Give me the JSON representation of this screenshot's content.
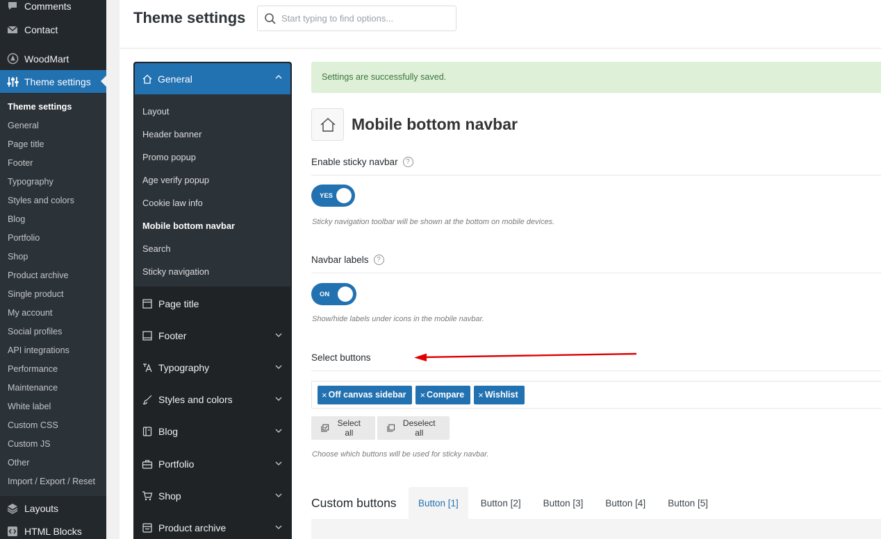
{
  "wp_menu": {
    "top_items": [
      {
        "label": "Comments",
        "icon": "comments-icon"
      },
      {
        "label": "Contact",
        "icon": "mail-icon"
      },
      {
        "label": "WoodMart",
        "icon": "woodmart-icon"
      },
      {
        "label": "Theme settings",
        "icon": "sliders-icon"
      }
    ],
    "submenu": [
      "Theme settings",
      "General",
      "Page title",
      "Footer",
      "Typography",
      "Styles and colors",
      "Blog",
      "Portfolio",
      "Shop",
      "Product archive",
      "Single product",
      "My account",
      "Social profiles",
      "API integrations",
      "Performance",
      "Maintenance",
      "White label",
      "Custom CSS",
      "Custom JS",
      "Other",
      "Import / Export / Reset"
    ],
    "bottom_items": [
      {
        "label": "Layouts",
        "icon": "layers-icon"
      },
      {
        "label": "HTML Blocks",
        "icon": "code-icon"
      }
    ]
  },
  "header": {
    "title": "Theme settings",
    "search_placeholder": "Start typing to find options..."
  },
  "settings_nav": {
    "active_group": "General",
    "active_subitems": [
      "Layout",
      "Header banner",
      "Promo popup",
      "Age verify popup",
      "Cookie law info",
      "Mobile bottom navbar",
      "Search",
      "Sticky navigation"
    ],
    "groups": [
      "Page title",
      "Footer",
      "Typography",
      "Styles and colors",
      "Blog",
      "Portfolio",
      "Shop",
      "Product archive"
    ]
  },
  "notice": "Settings are successfully saved.",
  "section": {
    "title": "Mobile bottom navbar",
    "help_glyph": "?",
    "sticky": {
      "label": "Enable sticky navbar",
      "toggle": "YES",
      "desc": "Sticky navigation toolbar will be shown at the bottom on mobile devices."
    },
    "labels": {
      "label": "Navbar labels",
      "toggle": "ON",
      "desc": "Show/hide labels under icons in the mobile navbar."
    },
    "buttons": {
      "label": "Select buttons",
      "chip_remove": "×",
      "chips": [
        "Off canvas sidebar",
        "Compare",
        "Wishlist"
      ],
      "select_all": "Select all",
      "deselect_all": "Deselect all",
      "desc": "Choose which buttons will be used for sticky navbar."
    },
    "custom": {
      "title": "Custom buttons",
      "tabs": [
        "Button [1]",
        "Button [2]",
        "Button [3]",
        "Button [4]",
        "Button [5]"
      ]
    }
  },
  "colors": {
    "accent": "#2271b1",
    "sidebar_bg": "#23282d",
    "notice_bg": "#dff0d8",
    "arrow": "#e00000"
  }
}
